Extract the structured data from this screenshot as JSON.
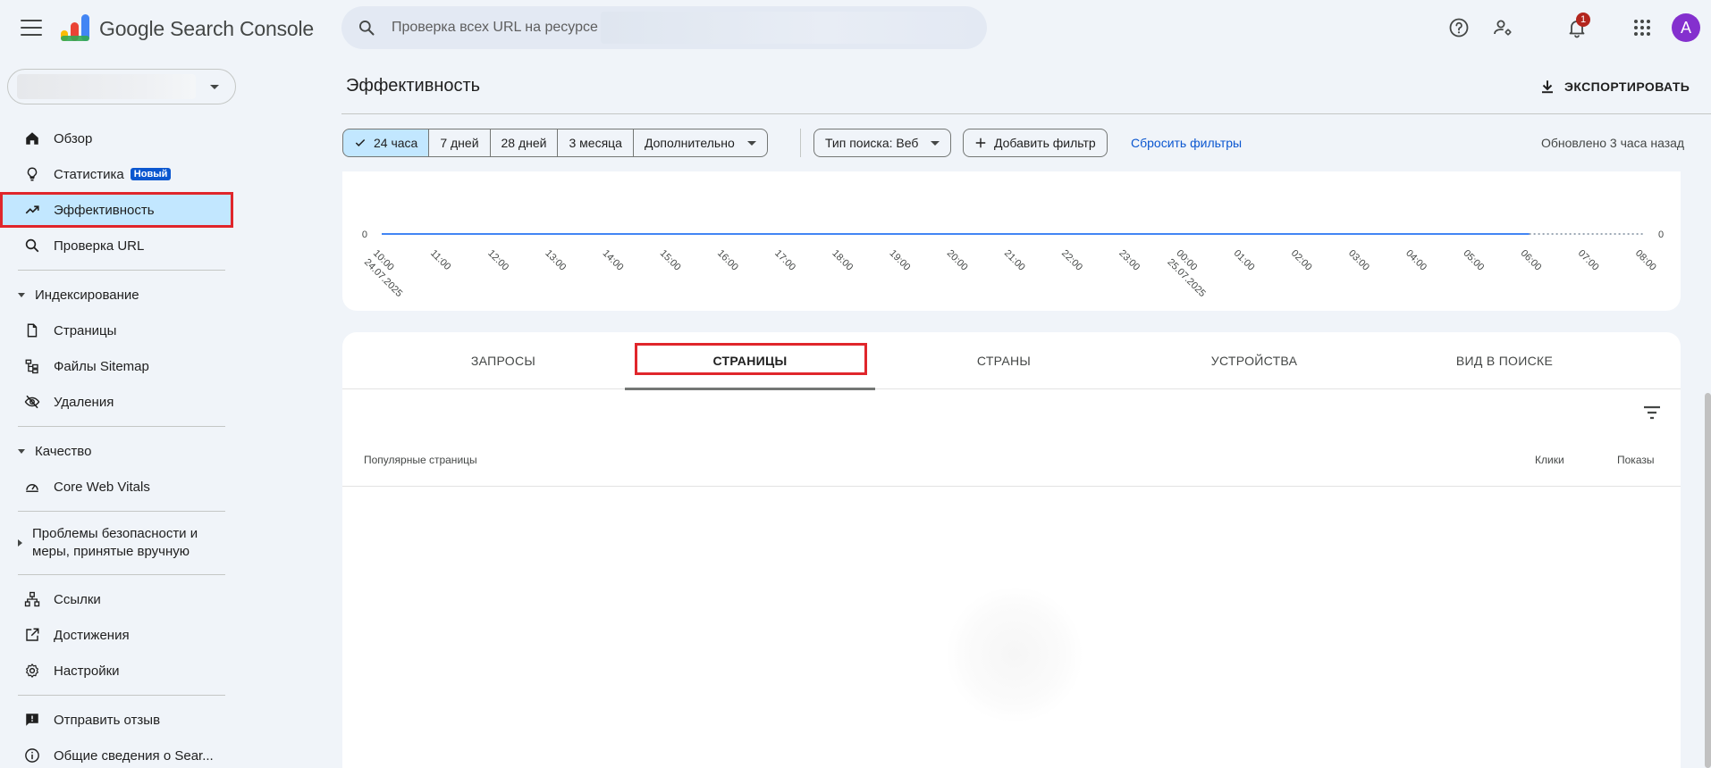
{
  "app": {
    "title": "Google Search Console",
    "search_placeholder": "Проверка всех URL на ресурсе",
    "notification_count": "1",
    "avatar_letter": "A"
  },
  "sidebar": {
    "main_items": [
      {
        "label": "Обзор",
        "icon": "home-icon"
      },
      {
        "label": "Статистика",
        "icon": "lightbulb-icon",
        "badge": "Новый"
      },
      {
        "label": "Эффективность",
        "icon": "trending-up-icon",
        "active": true
      },
      {
        "label": "Проверка URL",
        "icon": "search-icon"
      }
    ],
    "indexing": {
      "title": "Индексирование",
      "items": [
        {
          "label": "Страницы",
          "icon": "pages-icon"
        },
        {
          "label": "Файлы Sitemap",
          "icon": "sitemap-icon"
        },
        {
          "label": "Удаления",
          "icon": "visibility-off-icon"
        }
      ]
    },
    "quality": {
      "title": "Качество",
      "items": [
        {
          "label": "Core Web Vitals",
          "icon": "speed-icon"
        }
      ]
    },
    "security": {
      "title_line1": "Проблемы безопасности и",
      "title_line2": "меры, принятые вручную"
    },
    "other_items": [
      {
        "label": "Ссылки",
        "icon": "links-icon"
      },
      {
        "label": "Достижения",
        "icon": "open-in-new-icon"
      },
      {
        "label": "Настройки",
        "icon": "settings-icon"
      }
    ],
    "footer_items": [
      {
        "label": "Отправить отзыв",
        "icon": "feedback-icon"
      },
      {
        "label": "Общие сведения о Sear...",
        "icon": "info-icon"
      }
    ]
  },
  "main": {
    "title": "Эффективность",
    "export_label": "ЭКСПОРТИРОВАТЬ",
    "date_ranges": [
      "24 часа",
      "7 дней",
      "28 дней",
      "3 месяца"
    ],
    "date_more": "Дополнительно",
    "search_type": "Тип поиска: Веб",
    "add_filter": "Добавить фильтр",
    "reset_filters": "Сбросить фильтры",
    "updated": "Обновлено 3 часа назад"
  },
  "chart_data": {
    "type": "line",
    "x": [
      "10:00",
      "11:00",
      "12:00",
      "13:00",
      "14:00",
      "15:00",
      "16:00",
      "17:00",
      "18:00",
      "19:00",
      "20:00",
      "21:00",
      "22:00",
      "23:00",
      "00:00",
      "01:00",
      "02:00",
      "03:00",
      "04:00",
      "05:00",
      "06:00",
      "07:00",
      "08:00"
    ],
    "date_labels": {
      "0": "24.07.2025",
      "14": "25.07.2025"
    },
    "series": [
      {
        "values": [
          0,
          0,
          0,
          0,
          0,
          0,
          0,
          0,
          0,
          0,
          0,
          0,
          0,
          0,
          0,
          0,
          0,
          0,
          0,
          0,
          0,
          null,
          null
        ],
        "style": "solid",
        "color": "#4285f4"
      },
      {
        "values": [
          null,
          null,
          null,
          null,
          null,
          null,
          null,
          null,
          null,
          null,
          null,
          null,
          null,
          null,
          null,
          null,
          null,
          null,
          null,
          null,
          0,
          0,
          0
        ],
        "style": "dotted",
        "color": "#4285f4"
      }
    ],
    "y_left_tick": "0",
    "y_right_tick": "0"
  },
  "table": {
    "tabs": [
      "ЗАПРОСЫ",
      "СТРАНИЦЫ",
      "СТРАНЫ",
      "УСТРОЙСТВА",
      "ВИД В ПОИСКЕ"
    ],
    "active_tab": 1,
    "columns": [
      "Популярные страницы",
      "Клики",
      "Показы"
    ]
  }
}
